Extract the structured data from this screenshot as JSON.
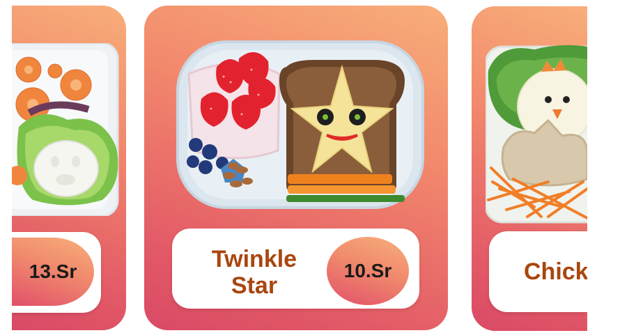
{
  "carousel": {
    "cards": [
      {
        "name": "",
        "price": "13.Sr"
      },
      {
        "name_line1": "Twinkle",
        "name_line2": "Star",
        "price": "10.Sr"
      },
      {
        "name": "Chick",
        "price": ""
      }
    ]
  },
  "colors": {
    "card_gradient_top": "#f8ae7a",
    "card_gradient_bottom": "#d94965",
    "name_text": "#a9460f",
    "price_text": "#1a1a1a",
    "panel": "#ffffff"
  }
}
